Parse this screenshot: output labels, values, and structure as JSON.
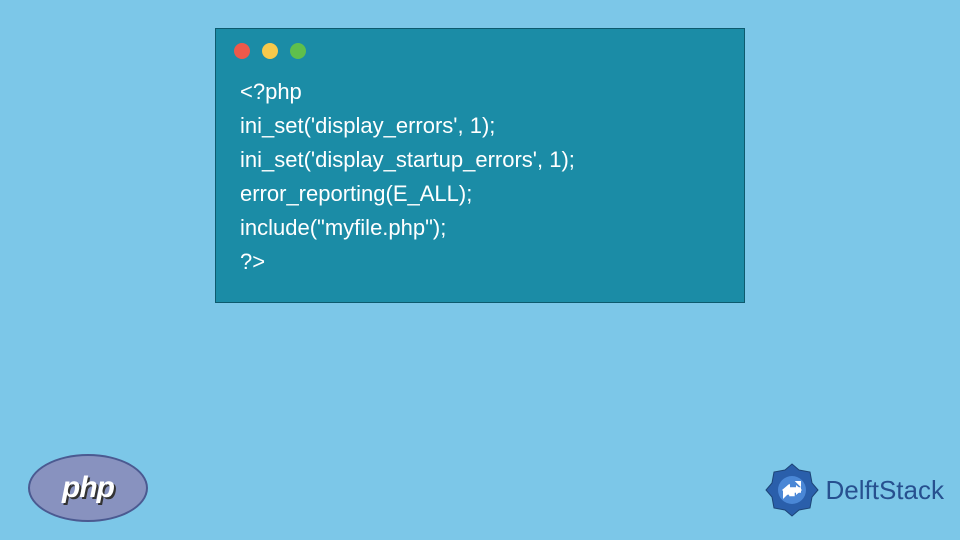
{
  "code": {
    "lines": [
      "<?php",
      "ini_set('display_errors', 1);",
      "ini_set('display_startup_errors', 1);",
      "error_reporting(E_ALL);",
      "include(\"myfile.php\");",
      "?>"
    ]
  },
  "php_logo": {
    "text": "php"
  },
  "brand": {
    "text": "DelftStack"
  },
  "colors": {
    "page_bg": "#7cc7e8",
    "window_bg": "#1b8ca6",
    "code_text": "#ffffff",
    "php_ellipse": "#8892bf",
    "brand_text": "#27508f"
  }
}
